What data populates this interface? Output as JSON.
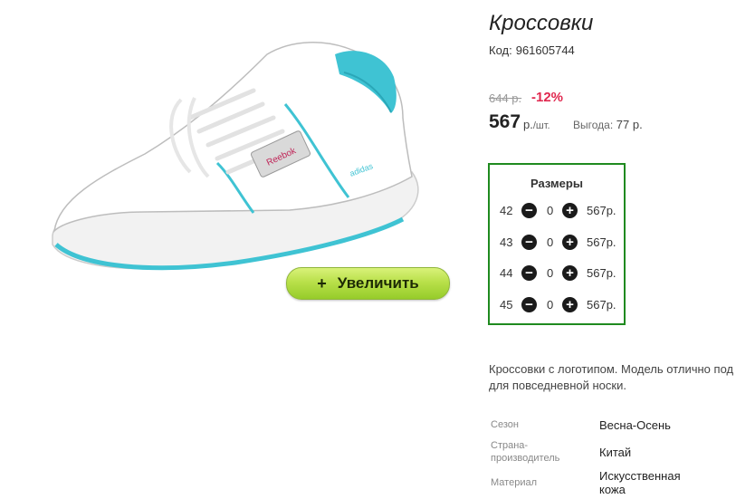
{
  "product": {
    "title": "Кроссовки",
    "code_label": "Код:",
    "code_value": "961605744"
  },
  "zoom": {
    "icon": "+",
    "label": "Увеличить"
  },
  "pricing": {
    "old_price": "644 р.",
    "discount": "-12%",
    "price": "567",
    "currency": "р.",
    "unit": "/шт.",
    "benefit_label": "Выгода:",
    "benefit_value": "77 р."
  },
  "sizes": {
    "title": "Размеры",
    "rows": [
      {
        "size": "42",
        "qty": "0",
        "price": "567р."
      },
      {
        "size": "43",
        "qty": "0",
        "price": "567р."
      },
      {
        "size": "44",
        "qty": "0",
        "price": "567р."
      },
      {
        "size": "45",
        "qty": "0",
        "price": "567р."
      }
    ]
  },
  "description": {
    "line1": "Кроссовки с логотипом. Модель отлично под",
    "line2": "для повседневной носки."
  },
  "specs": [
    {
      "label": "Сезон",
      "value": "Весна-Осень"
    },
    {
      "label_line1": "Страна-",
      "label_line2": "производитель",
      "value": "Китай"
    },
    {
      "label": "Материал",
      "value_line1": "Искусственная",
      "value_line2": "кожа"
    }
  ],
  "colors": {
    "accent_green": "#1f8a1f",
    "discount_red": "#e0284f",
    "button_green": "#b9e04a",
    "shoe_accent": "#3fc3d3"
  },
  "icons": [
    "minus-circle-icon",
    "plus-circle-icon",
    "plus-icon"
  ]
}
